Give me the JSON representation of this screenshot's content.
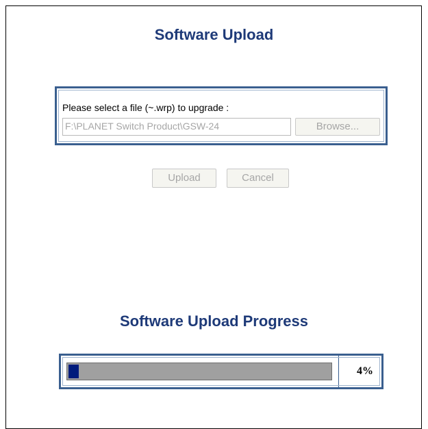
{
  "upload": {
    "title": "Software Upload",
    "prompt": "Please select a file (~.wrp) to upgrade :",
    "file_value": "F:\\PLANET Switch Product\\GSW-24",
    "browse_label": "Browse...",
    "upload_label": "Upload",
    "cancel_label": "Cancel"
  },
  "progress": {
    "title": "Software Upload Progress",
    "percent": 4,
    "percent_label": "4%",
    "fill_color": "#001c7c",
    "track_color": "#a0a0a0"
  },
  "colors": {
    "title": "#1e3a78",
    "box_border": "#3a5f8f"
  }
}
